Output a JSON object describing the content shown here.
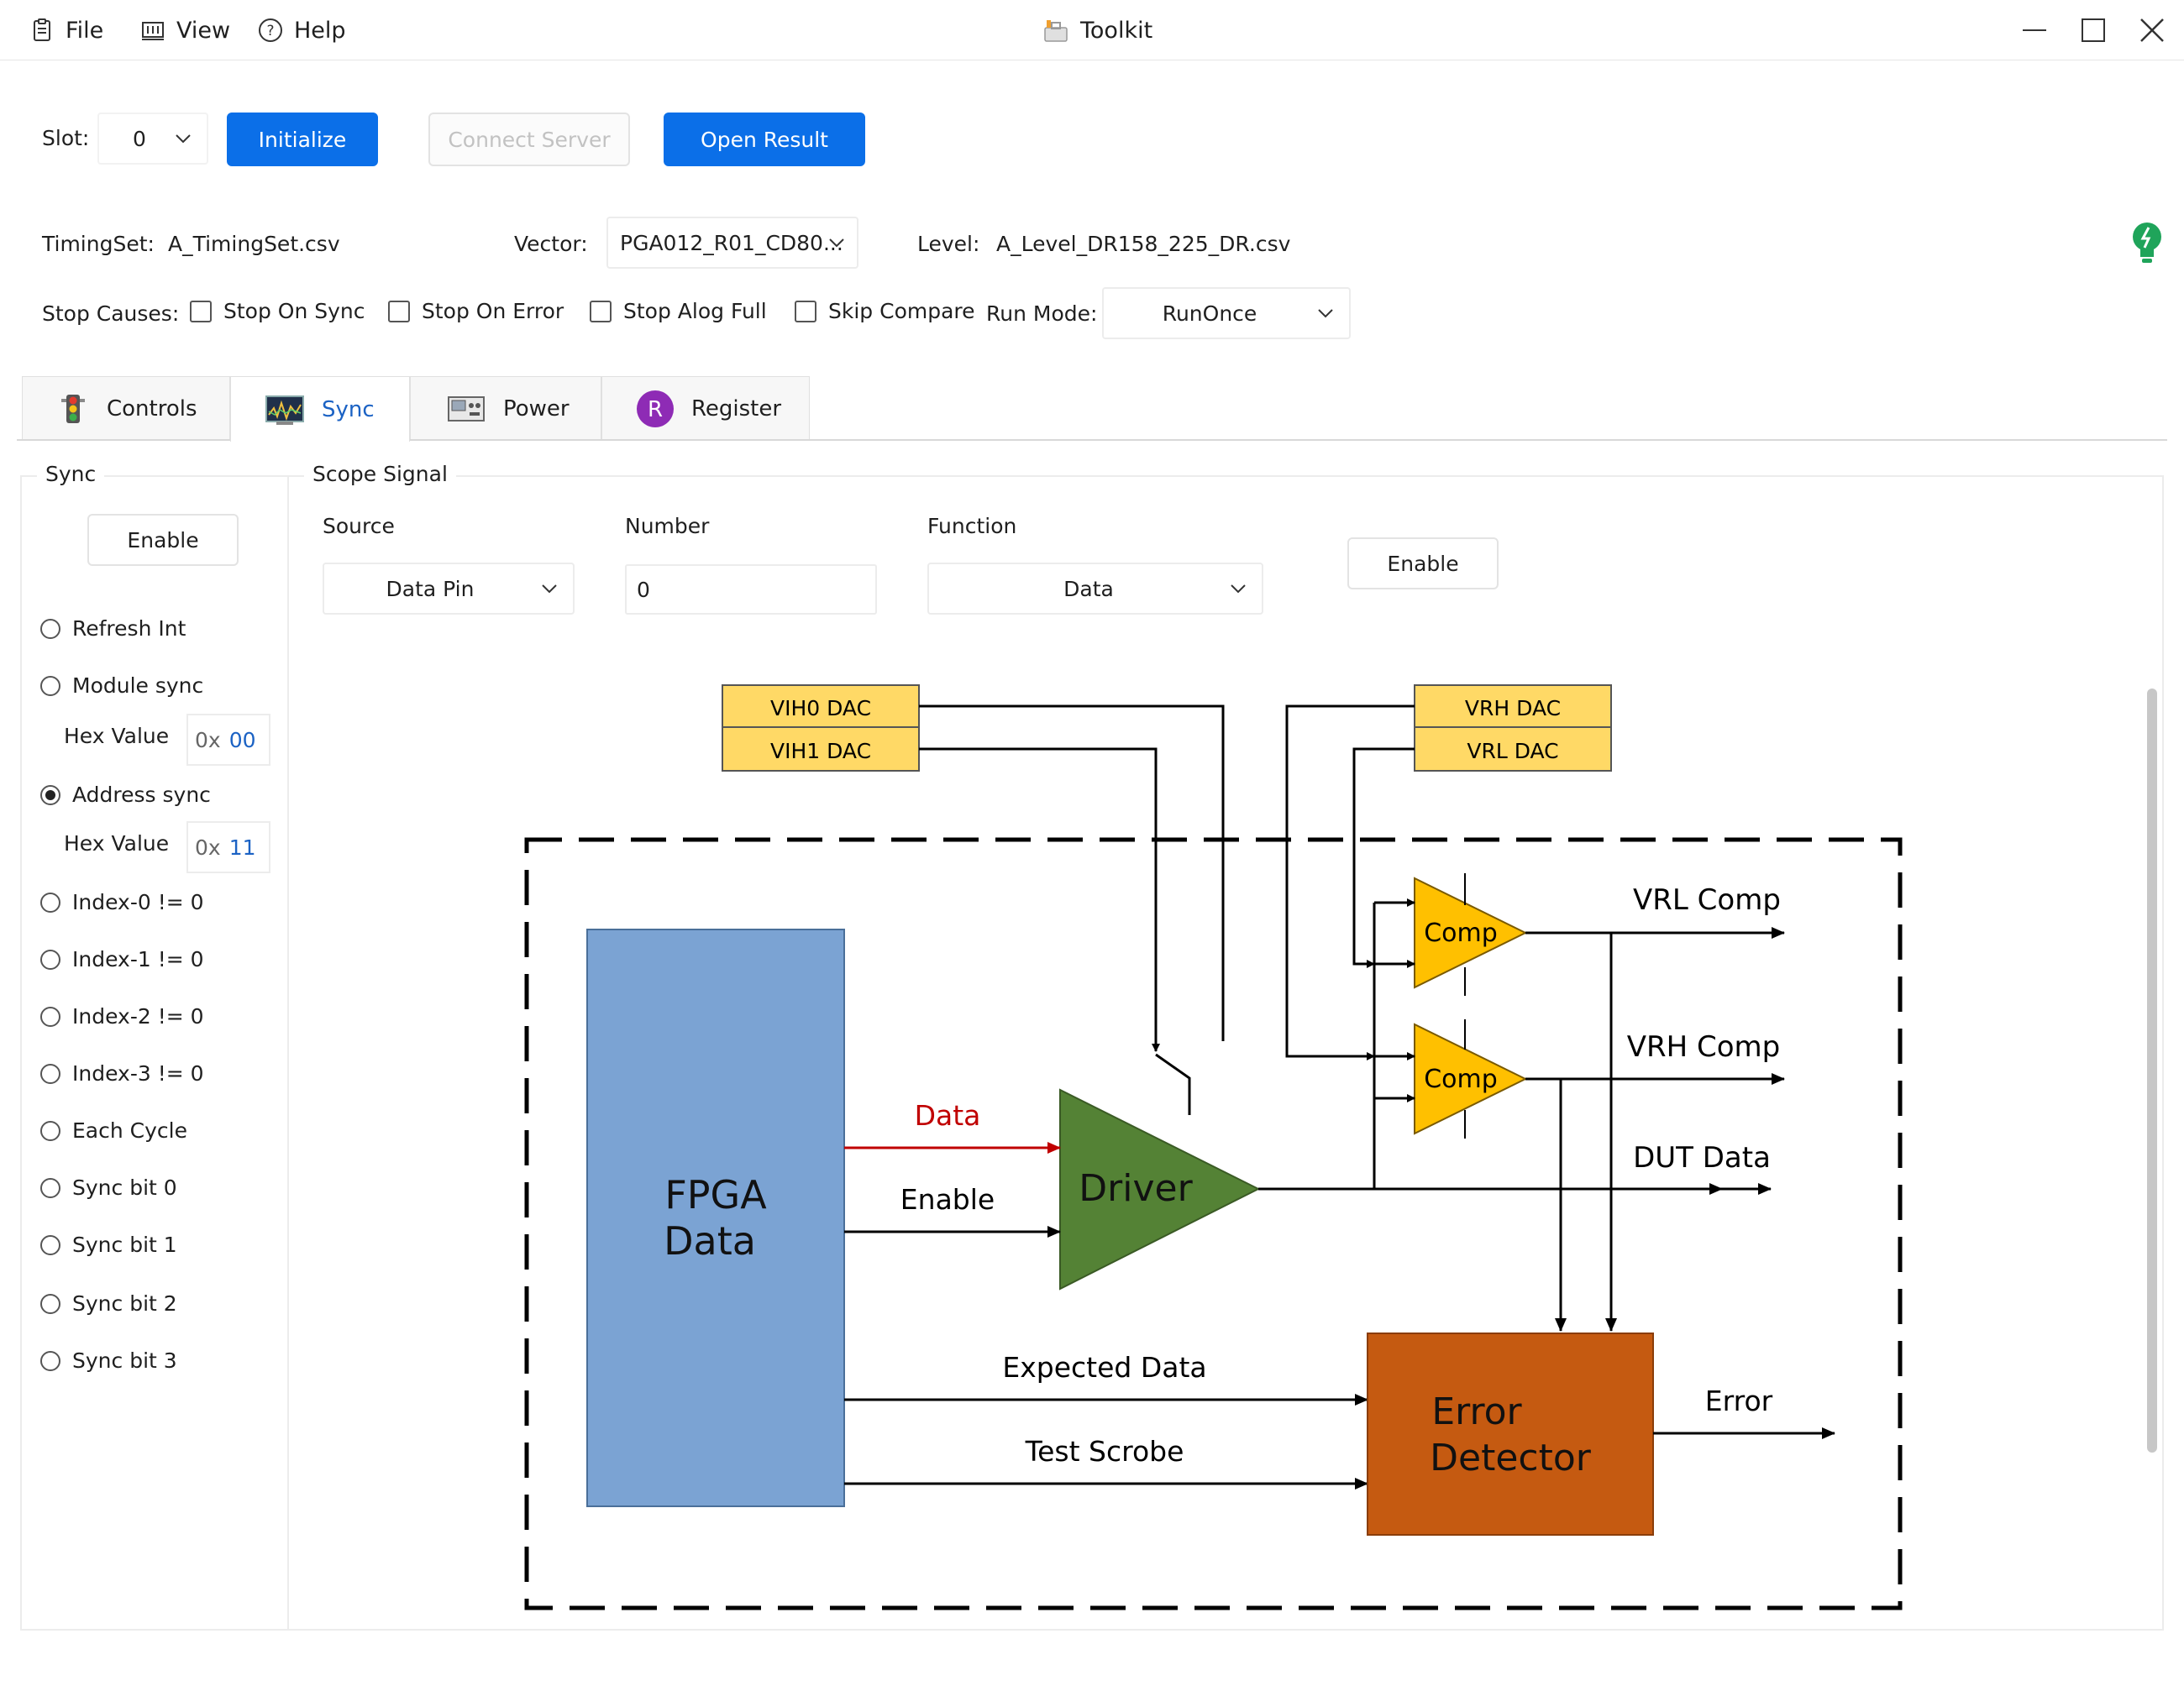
{
  "window": {
    "title": "Toolkit"
  },
  "menu": {
    "file": "File",
    "view": "View",
    "help": "Help"
  },
  "toolbar": {
    "slot_label": "Slot:",
    "slot_value": "0",
    "initialize": "Initialize",
    "connect_server": "Connect Server",
    "open_result": "Open Result"
  },
  "config": {
    "timingset_label": "TimingSet:",
    "timingset_value": "A_TimingSet.csv",
    "vector_label": "Vector:",
    "vector_value": "PGA012_R01_CD80...",
    "level_label": "Level:",
    "level_value": "A_Level_DR158_225_DR.csv"
  },
  "stop_causes": {
    "label": "Stop Causes:",
    "options": [
      "Stop On Sync",
      "Stop On Error",
      "Stop Alog Full",
      "Skip Compare"
    ],
    "run_mode_label": "Run Mode:",
    "run_mode_value": "RunOnce"
  },
  "tabs": [
    "Controls",
    "Sync",
    "Power",
    "Register"
  ],
  "active_tab": "Sync",
  "sync": {
    "title": "Sync",
    "enable": "Enable",
    "options": [
      {
        "label": "Refresh Int",
        "checked": false
      },
      {
        "label": "Module sync",
        "checked": false
      },
      {
        "label": "Address sync",
        "checked": true
      },
      {
        "label": "Index-0 != 0",
        "checked": false
      },
      {
        "label": "Index-1 != 0",
        "checked": false
      },
      {
        "label": "Index-2 != 0",
        "checked": false
      },
      {
        "label": "Index-3 != 0",
        "checked": false
      },
      {
        "label": "Each Cycle",
        "checked": false
      },
      {
        "label": "Sync bit 0",
        "checked": false
      },
      {
        "label": "Sync bit 1",
        "checked": false
      },
      {
        "label": "Sync bit 2",
        "checked": false
      },
      {
        "label": "Sync bit 3",
        "checked": false
      }
    ],
    "hex_label": "Hex Value",
    "hex_prefix": "0x",
    "module_hex": "00",
    "address_hex": "11"
  },
  "scope": {
    "title": "Scope Signal",
    "source_label": "Source",
    "source_value": "Data Pin",
    "number_label": "Number",
    "number_value": "0",
    "function_label": "Function",
    "function_value": "Data",
    "enable": "Enable"
  },
  "diagram": {
    "vih0": "VIH0 DAC",
    "vih1": "VIH1 DAC",
    "vrh": "VRH DAC",
    "vrl": "VRL DAC",
    "comp": "Comp",
    "vrl_comp": "VRL Comp",
    "vrh_comp": "VRH Comp",
    "dut_data": "DUT Data",
    "fpga_line1": "FPGA",
    "fpga_line2": "Data",
    "data": "Data",
    "enable": "Enable",
    "driver": "Driver",
    "expected_data": "Expected Data",
    "test_scrobe": "Test Scrobe",
    "error_line1": "Error",
    "error_line2": "Detector",
    "error": "Error"
  },
  "colors": {
    "accent": "#0b6fe8",
    "fpga": "#7ba3d3",
    "driver": "#548235",
    "error_detector": "#c55a11",
    "comp": "#ffc000",
    "dac": "#ffd966",
    "data_arrow": "#c00000",
    "status_bulb": "#1fa45a"
  }
}
